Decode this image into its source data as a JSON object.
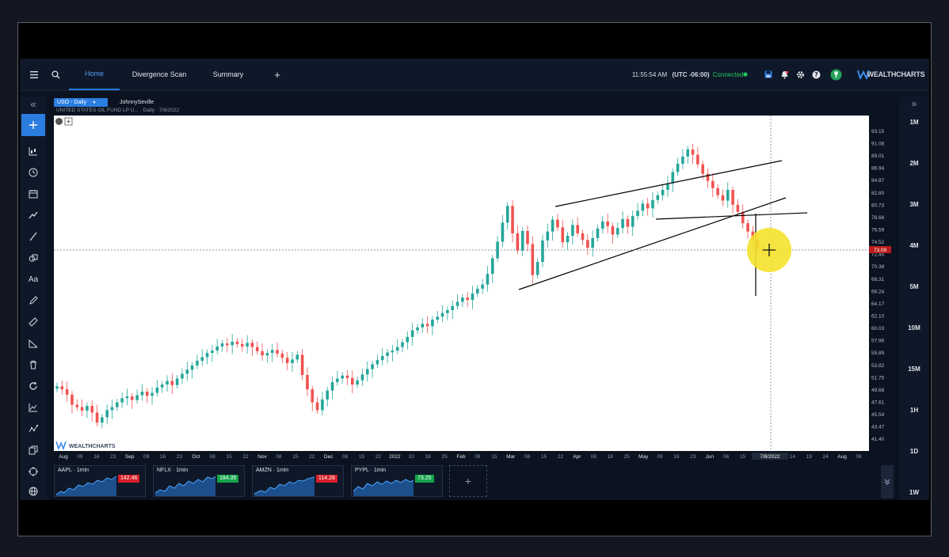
{
  "topbar": {
    "tabs": [
      {
        "label": "Home",
        "active": true
      },
      {
        "label": "Divergence Scan",
        "active": false
      },
      {
        "label": "Summary",
        "active": false
      }
    ],
    "add_tab": "+",
    "time": "11:55:54 AM",
    "timezone": "(UTC -06:00)",
    "status": "Connected",
    "brand": "WEALTHCHARTS"
  },
  "symbol_bar": {
    "symbol_tab": "USO - Daily",
    "user_tab": "JohnnySeville",
    "description": "UNITED STATES OIL FUND LP U...",
    "interval_date": "· Daily · 7/8/2022"
  },
  "left_toolbar": {
    "collapse": "«",
    "tools": [
      "plus-icon",
      "candles-icon",
      "clock-icon",
      "calendar-icon",
      "trend-icon",
      "line-draw-icon",
      "shapes-icon",
      "text-icon",
      "pencil-icon",
      "ruler-icon",
      "measure-icon",
      "trash-icon",
      "refresh-icon",
      "indicator-icon",
      "pattern-icon",
      "copy-icon",
      "target-icon",
      "globe-icon"
    ]
  },
  "right_toolbar": {
    "collapse": "»",
    "timeframes": [
      "1M",
      "2M",
      "3M",
      "4M",
      "5M",
      "10M",
      "15M",
      "1H",
      "1D",
      "1W"
    ]
  },
  "chart_data": {
    "type": "candlestick",
    "price_axis": [
      "93.15",
      "91.08",
      "89.01",
      "86.94",
      "84.87",
      "82.80",
      "80.73",
      "78.66",
      "76.59",
      "74.52",
      "72.45",
      "70.38",
      "68.31",
      "66.24",
      "64.17",
      "62.10",
      "60.03",
      "57.96",
      "55.89",
      "53.82",
      "51.75",
      "49.68",
      "47.61",
      "45.54",
      "43.47",
      "41.40"
    ],
    "date_axis": [
      "Aug",
      "09",
      "16",
      "23",
      "Sep",
      "09",
      "16",
      "23",
      "Oct",
      "08",
      "15",
      "22",
      "Nov",
      "08",
      "15",
      "22",
      "Dec",
      "08",
      "15",
      "22",
      "2022",
      "10",
      "18",
      "25",
      "Feb",
      "08",
      "15",
      "Mar",
      "08",
      "15",
      "22",
      "Apr",
      "08",
      "18",
      "25",
      "May",
      "09",
      "16",
      "23",
      "Jun",
      "06",
      "15",
      "23",
      "7/8/2022",
      "14",
      "19",
      "24",
      "Aug",
      "06"
    ],
    "crosshair_price": "73.09",
    "crosshair_date": "7/8/2022",
    "watermark": "WEALTHCHARTS",
    "ylim": [
      40.5,
      94.2
    ],
    "closes": [
      50.3,
      49.8,
      48.9,
      47.2,
      46.8,
      46.2,
      47.0,
      45.9,
      44.2,
      45.1,
      46.3,
      46.8,
      47.6,
      48.3,
      48.6,
      48.0,
      48.8,
      49.4,
      48.7,
      49.2,
      50.1,
      50.6,
      51.2,
      50.5,
      51.6,
      52.4,
      53.1,
      53.8,
      54.6,
      55.2,
      55.9,
      56.3,
      57.0,
      57.5,
      57.2,
      57.8,
      57.4,
      57.0,
      57.6,
      56.9,
      56.2,
      55.5,
      55.9,
      56.4,
      55.8,
      55.1,
      54.2,
      54.8,
      55.6,
      52.2,
      49.8,
      47.6,
      46.3,
      48.1,
      49.6,
      51.0,
      51.6,
      52.1,
      51.7,
      50.6,
      51.3,
      52.3,
      53.2,
      54.0,
      54.7,
      55.4,
      56.0,
      56.3,
      56.9,
      57.7,
      58.6,
      59.7,
      60.2,
      60.8,
      60.4,
      61.5,
      62.0,
      62.6,
      63.1,
      63.8,
      64.5,
      65.2,
      64.8,
      65.9,
      66.7,
      67.4,
      69.2,
      71.8,
      74.6,
      77.8,
      80.6,
      76.0,
      73.1,
      76.4,
      74.2,
      69.0,
      71.2,
      74.8,
      76.3,
      78.3,
      77.0,
      74.5,
      75.6,
      77.4,
      76.0,
      74.9,
      73.6,
      75.2,
      76.8,
      78.0,
      77.2,
      75.8,
      76.9,
      78.4,
      77.1,
      78.9,
      79.8,
      81.0,
      80.2,
      81.6,
      82.4,
      83.3,
      84.4,
      86.3,
      87.7,
      88.9,
      90.1,
      89.2,
      87.6,
      86.0,
      84.8,
      83.6,
      82.4,
      81.5,
      83.3,
      80.8,
      79.6,
      77.7,
      76.3,
      74.8,
      73.4,
      73.09
    ]
  },
  "drawings": {
    "trendlines": 4
  },
  "watchlist": [
    {
      "label": "AAPL · 1min",
      "price": "142.46",
      "color": "#d61f2a"
    },
    {
      "label": "NFLX · 1min",
      "price": "184.35",
      "color": "#13a34a"
    },
    {
      "label": "AMZN · 1min",
      "price": "114.28",
      "color": "#d61f2a"
    },
    {
      "label": "PYPL · 1min",
      "price": "73.25",
      "color": "#13a34a"
    }
  ],
  "add_widget": "+",
  "colors": {
    "up": "#26a69a",
    "down": "#ef5350",
    "accent": "#2b7de0",
    "bg": "#0b1220"
  }
}
